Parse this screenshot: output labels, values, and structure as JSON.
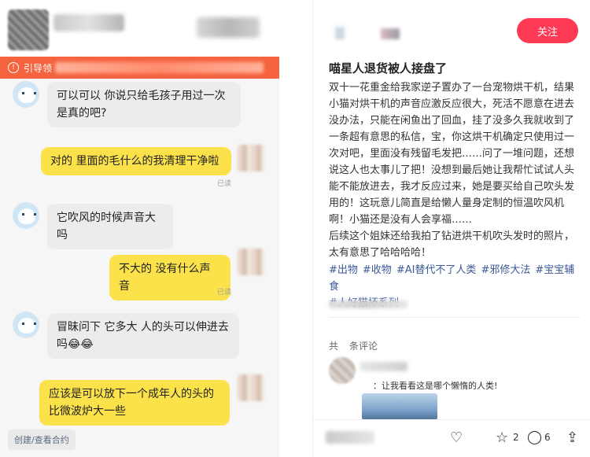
{
  "left_panel": {
    "notice_prefix": "引导领",
    "notice_icon": "info-icon",
    "messages": [
      {
        "side": "left",
        "text": "可以可以 你说只给毛孩子用过一次是真的吧?"
      },
      {
        "side": "right",
        "text": "对的 里面的毛什么的我清理干净啦",
        "status": "已读"
      },
      {
        "side": "left",
        "text": "它吹风的时候声音大吗"
      },
      {
        "side": "right",
        "text": "不大的 没有什么声音",
        "status": "已读"
      },
      {
        "side": "left",
        "text": "冒昧问下 它多大 人的头可以伸进去吗😂😂"
      },
      {
        "side": "right",
        "text": "应该是可以放下一个成年人的头的 比微波炉大一些"
      }
    ],
    "contract_label": "创建/查看合约"
  },
  "right_panel": {
    "follow_label": "关注",
    "post_title": "喵星人退货被人接盘了",
    "post_body": "双十一花重金给我家逆子置办了一台宠物烘干机，结果小猫对烘干机的声音应激反应很大，死活不愿意在进去没办法，只能在闲鱼出了回血，挂了没多久我就收到了一条超有意思的私信，宝，你这烘干机确定只使用过一次对吧，里面没有残留毛发把……问了一堆问题，还想说这人也太事儿了把！没想到最后她让我帮忙试试人头能不能放进去，我才反应过来，她是要买给自己吹头发用的！这玩意儿简直是给懒人量身定制的恒温吹风机啊！小猫还是没有人会享福……\n后续这个姐妹还给我拍了钻进烘干机吹头发时的照片，太有意思了哈哈哈哈！",
    "tags": [
      "#出物",
      "#收物",
      "#AI替代不了人类",
      "#邪修大法",
      "#宝宝辅食",
      "#人好猫坏系列"
    ],
    "comments_prefix": "共",
    "comments_suffix": "条评论",
    "comment_text": "：让我看看这是哪个懒惰的人类!",
    "bottom": {
      "like_icon": "heart-icon",
      "star_icon": "star-icon",
      "star_count": "2",
      "comment_icon": "comment-icon",
      "comment_count": "6",
      "share_icon": "share-icon"
    }
  },
  "colors": {
    "follow": "#ff3a55",
    "notice": "#f5633f",
    "bubble_right": "#fbe24a",
    "bubble_left": "#ececec",
    "tag": "#3b5998"
  }
}
